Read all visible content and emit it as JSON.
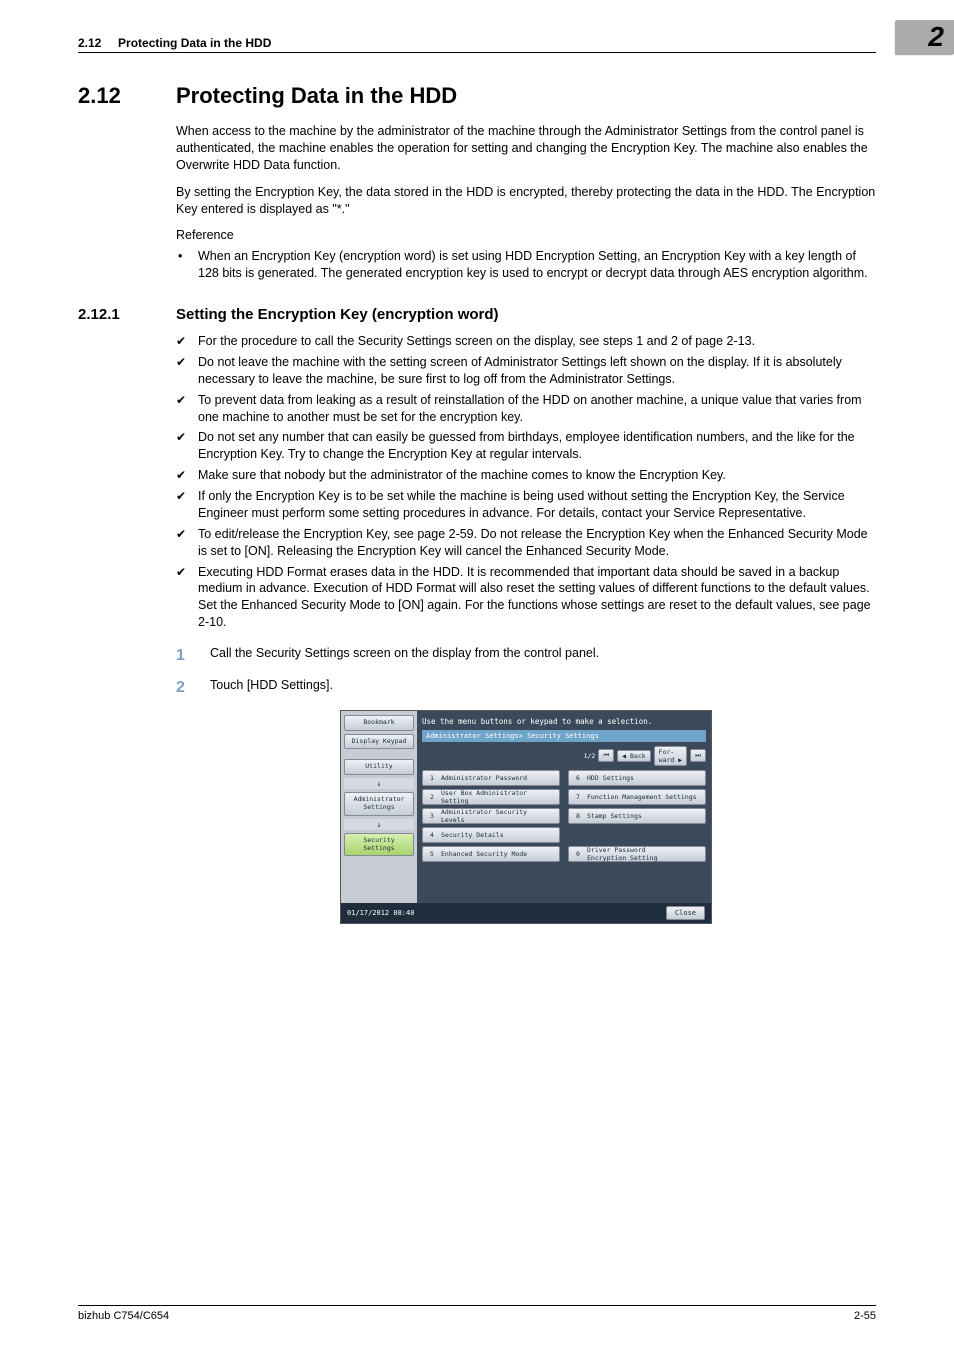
{
  "header": {
    "section_ref": "2.12",
    "section_title": "Protecting Data in the HDD",
    "chapter_marker": "2"
  },
  "section": {
    "number": "2.12",
    "title": "Protecting Data in the HDD",
    "para1": "When access to the machine by the administrator of the machine through the Administrator Settings from the control panel is authenticated, the machine enables the operation for setting and changing the Encryption Key. The machine also enables the Overwrite HDD Data function.",
    "para2": "By setting the Encryption Key, the data stored in the HDD is encrypted, thereby protecting the data in the HDD. The Encryption Key entered is displayed as \"*.\"",
    "reference_label": "Reference",
    "reference_item": "When an Encryption Key (encryption word) is set using HDD Encryption Setting, an Encryption Key with a key length of 128 bits is generated. The generated encryption key is used to encrypt or decrypt data through AES encryption algorithm."
  },
  "subsection": {
    "number": "2.12.1",
    "title": "Setting the Encryption Key (encryption word)",
    "checks": [
      "For the procedure to call the Security Settings screen on the display, see steps 1 and 2 of page 2-13.",
      "Do not leave the machine with the setting screen of Administrator Settings left shown on the display. If it is absolutely necessary to leave the machine, be sure first to log off from the Administrator Settings.",
      "To prevent data from leaking as a result of reinstallation of the HDD on another machine, a unique value that varies from one machine to another must be set for the encryption key.",
      "Do not set any number that can easily be guessed from birthdays, employee identification numbers, and the like for the Encryption Key. Try to change the Encryption Key at regular intervals.",
      "Make sure that nobody but the administrator of the machine comes to know the Encryption Key.",
      "If only the Encryption Key is to be set while the machine is being used without setting the Encryption Key, the Service Engineer must perform some setting procedures in advance. For details, contact your Service Representative.",
      "To edit/release the Encryption Key, see page 2-59. Do not release the Encryption Key when the Enhanced Security Mode is set to [ON]. Releasing the Encryption Key will cancel the Enhanced Security Mode.",
      "Executing HDD Format erases data in the HDD. It is recommended that important data should be saved in a backup medium in advance. Execution of HDD Format will also reset the setting values of different functions to the default values. Set the Enhanced Security Mode to [ON] again. For the functions whose settings are reset to the default values, see page 2-10."
    ],
    "steps": [
      "Call the Security Settings screen on the display from the control panel.",
      "Touch [HDD Settings]."
    ]
  },
  "screenshot": {
    "hint": "Use the menu buttons or keypad to make a selection.",
    "breadcrumb": "Administrator Settings> Security Settings",
    "page_indicator": "1/2",
    "back_label": "Back",
    "forward_label": "For-\nward",
    "side": {
      "bookmark": "Bookmark",
      "display_keypad": "Display Keypad",
      "utility": "Utility",
      "admin_settings": "Administrator\nSettings",
      "security_settings": "Security\nSettings"
    },
    "menu": [
      {
        "n": "1",
        "label": "Administrator Password"
      },
      {
        "n": "2",
        "label": "User Box Administrator\nSetting"
      },
      {
        "n": "3",
        "label": "Administrator Security\nLevels"
      },
      {
        "n": "4",
        "label": "Security Details"
      },
      {
        "n": "5",
        "label": "Enhanced Security Mode"
      },
      {
        "n": "6",
        "label": "HDD Settings"
      },
      {
        "n": "7",
        "label": "Function Management Settings"
      },
      {
        "n": "8",
        "label": "Stamp Settings"
      },
      {
        "n": "0",
        "label": "Driver Password\nEncryption Setting"
      }
    ],
    "timestamp": "01/17/2012   08:40",
    "close": "Close"
  },
  "footer": {
    "left": "bizhub C754/C654",
    "right": "2-55"
  }
}
